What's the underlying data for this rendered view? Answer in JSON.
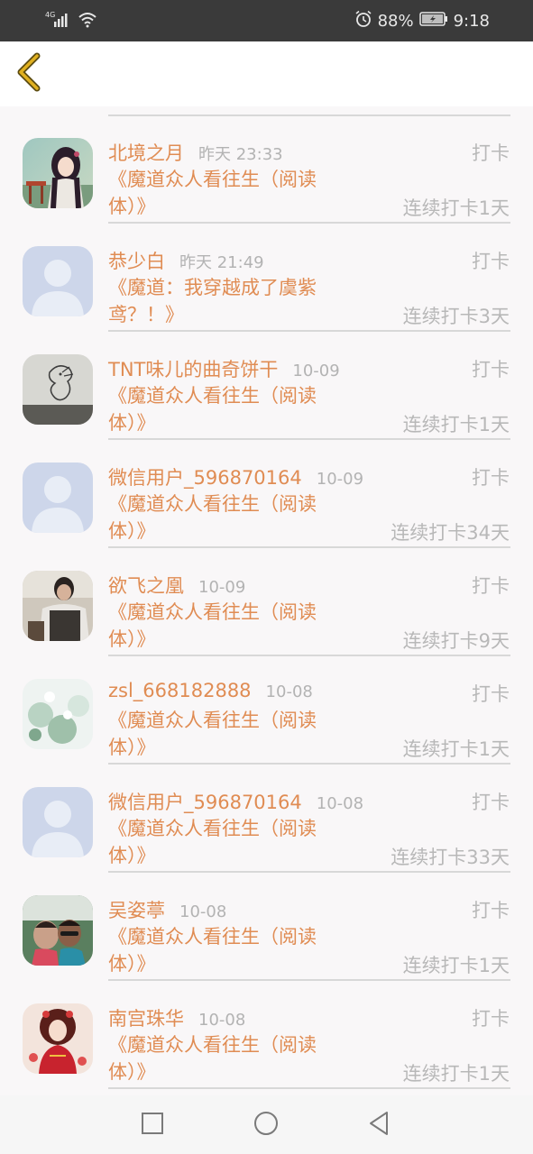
{
  "status_bar": {
    "network": "4G",
    "battery_percent": "88%",
    "time": "9:18",
    "icons": [
      "signal-icon",
      "wifi-icon",
      "alarm-icon",
      "battery-icon"
    ]
  },
  "header": {
    "back_icon": "chevron-left-icon"
  },
  "colors": {
    "name": "#e08c53",
    "muted": "#b8b8b8",
    "back_arrow": "#d9a400"
  },
  "rows": [
    {
      "name": "北境之月",
      "time": "昨天 23:33",
      "action": "打卡",
      "title": "《魔道众人看往生（阅读体）》",
      "streak": "连续打卡1天",
      "avatar": "anime-girl-portrait"
    },
    {
      "name": "恭少白",
      "time": "昨天 21:49",
      "action": "打卡",
      "title": "《魔道：我穿越成了虞紫鸢？！》",
      "streak": "连续打卡3天",
      "avatar": "default-avatar"
    },
    {
      "name": "TNT味儿的曲奇饼干",
      "time": "10-09",
      "action": "打卡",
      "title": "《魔道众人看往生（阅读体）》",
      "streak": "连续打卡1天",
      "avatar": "dragon-sketch"
    },
    {
      "name": "微信用户_596870164",
      "time": "10-09",
      "action": "打卡",
      "title": "《魔道众人看往生（阅读体）》",
      "streak": "连续打卡34天",
      "avatar": "default-avatar"
    },
    {
      "name": "欲飞之凰",
      "time": "10-09",
      "action": "打卡",
      "title": "《魔道众人看往生（阅读体）》",
      "streak": "连续打卡9天",
      "avatar": "person-photo"
    },
    {
      "name": "zsl_668182888",
      "time": "10-08",
      "action": "打卡",
      "title": "《魔道众人看往生（阅读体）》",
      "streak": "连续打卡1天",
      "avatar": "flower-photo"
    },
    {
      "name": "微信用户_596870164",
      "time": "10-08",
      "action": "打卡",
      "title": "《魔道众人看往生（阅读体）》",
      "streak": "连续打卡33天",
      "avatar": "default-avatar"
    },
    {
      "name": "吴姿葶",
      "time": "10-08",
      "action": "打卡",
      "title": "《魔道众人看往生（阅读体）》",
      "streak": "连续打卡1天",
      "avatar": "selfie-photo"
    },
    {
      "name": "南宫珠华",
      "time": "10-08",
      "action": "打卡",
      "title": "《魔道众人看往生（阅读体）》",
      "streak": "连续打卡1天",
      "avatar": "anime-red-dress"
    }
  ],
  "nav_bar": {
    "icons": [
      "recent-apps-icon",
      "home-icon",
      "back-triangle-icon"
    ]
  }
}
